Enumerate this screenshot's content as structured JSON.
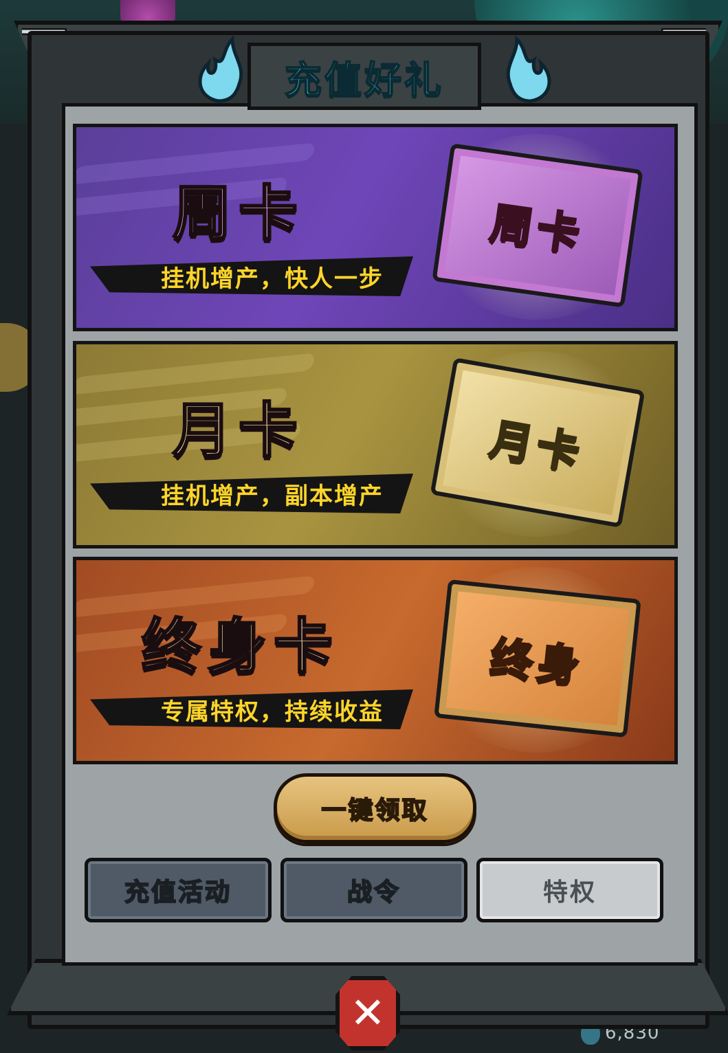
{
  "title": "充值好礼",
  "cards": [
    {
      "name": "周卡",
      "slogan": "挂机增产，快人一步",
      "ticket": "周卡",
      "color": "#6f46b8"
    },
    {
      "name": "月卡",
      "slogan": "挂机增产，副本增产",
      "ticket": "月卡",
      "color": "#a89440"
    },
    {
      "name": "终身卡",
      "slogan": "专属特权，持续收益",
      "ticket": "终身",
      "color": "#c76a2e"
    }
  ],
  "claim_all": "一键领取",
  "tabs": [
    {
      "label": "充值活动",
      "state": "inactive"
    },
    {
      "label": "战令",
      "state": "inactive"
    },
    {
      "label": "特权",
      "state": "active"
    }
  ],
  "close_icon": "close-icon",
  "background": {
    "currency_value": "6,830"
  }
}
